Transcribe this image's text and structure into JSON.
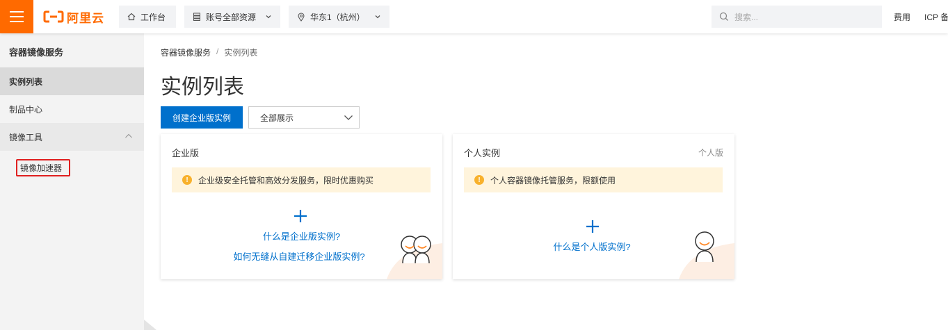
{
  "topbar": {
    "logo_text": "阿里云",
    "workbench": "工作台",
    "resources": "账号全部资源",
    "region": "华东1（杭州）",
    "search_placeholder": "搜索...",
    "links": [
      "费用",
      "ICP 备"
    ]
  },
  "sidebar": {
    "title": "容器镜像服务",
    "items": [
      {
        "label": "实例列表",
        "active": true
      },
      {
        "label": "制品中心"
      },
      {
        "label": "镜像工具",
        "group": true,
        "expanded": true
      }
    ],
    "sub_items": [
      {
        "label": "镜像加速器",
        "highlighted": true
      }
    ]
  },
  "breadcrumb": {
    "parent": "容器镜像服务",
    "separator": "/",
    "current": "实例列表"
  },
  "page": {
    "title": "实例列表",
    "create_button": "创建企业版实例",
    "filter_value": "全部展示"
  },
  "cards": [
    {
      "title": "企业版",
      "tag": "",
      "notice": "企业级安全托管和高效分发服务，限时优惠购买",
      "links": [
        "什么是企业版实例?",
        "如何无缝从自建迁移企业版实例?"
      ]
    },
    {
      "title": "个人实例",
      "tag": "个人版",
      "notice": "个人容器镜像托管服务，限额使用",
      "links": [
        "什么是个人版实例?"
      ]
    }
  ],
  "colors": {
    "brand": "#ff6a00",
    "primary": "#0070cc",
    "notice_bg": "#fff4dc",
    "warning": "#f8b12c",
    "highlight_border": "#e02020"
  }
}
